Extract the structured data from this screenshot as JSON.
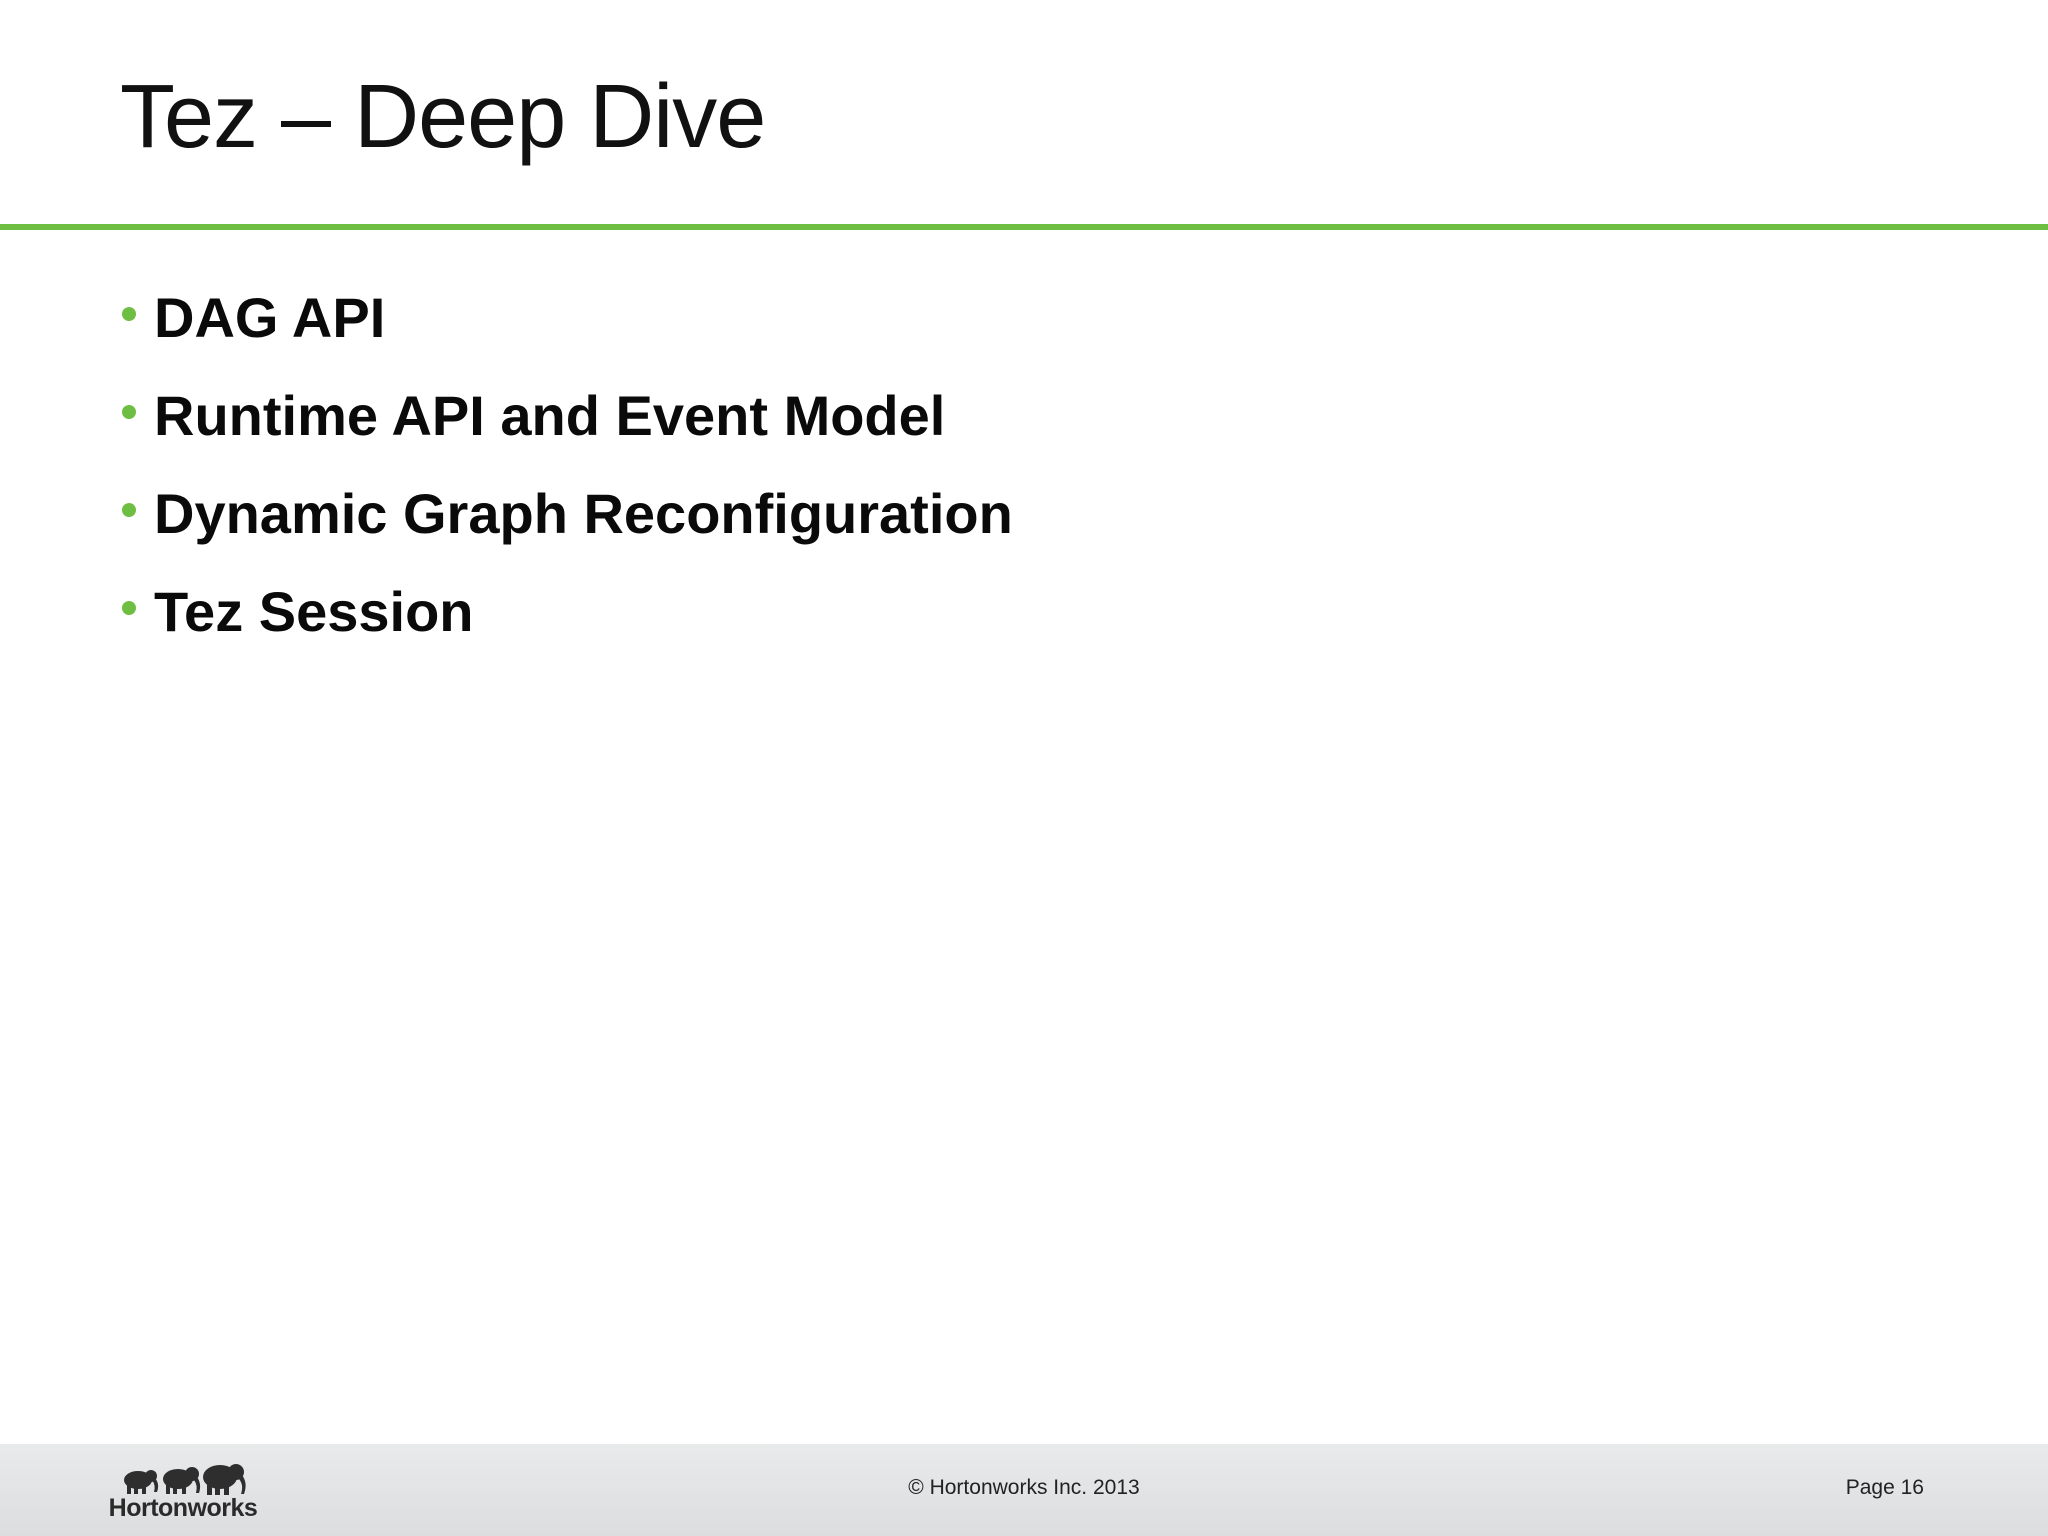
{
  "slide": {
    "title": "Tez – Deep Dive",
    "accent_color": "#6fbe44",
    "bullets": [
      "DAG API",
      "Runtime API and Event Model",
      "Dynamic Graph Reconfiguration",
      "Tez Session"
    ]
  },
  "footer": {
    "logo_text": "Hortonworks",
    "copyright": "© Hortonworks Inc. 2013",
    "page": "Page 16"
  }
}
